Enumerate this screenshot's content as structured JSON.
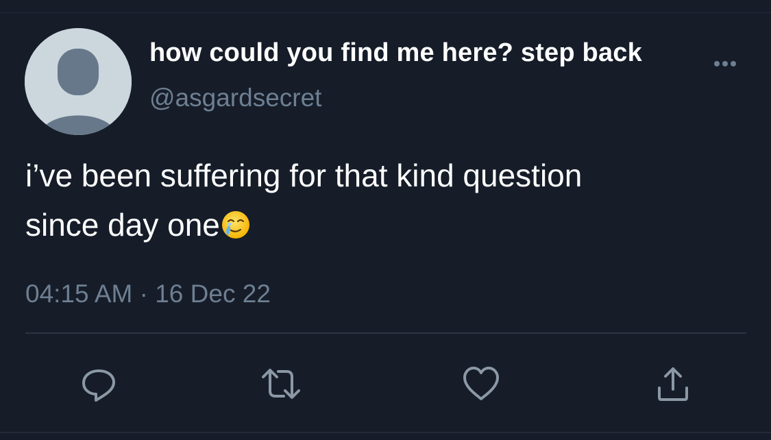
{
  "tweet": {
    "display_name": "how could you find me here? step back",
    "handle": "@asgardsecret",
    "text": "i’ve been suffering for that kind question\nsince day one",
    "emoji": "face-holding-back-tears",
    "time": "04:15 AM",
    "separator": "·",
    "date": "16 Dec 22"
  },
  "actions": {
    "reply_icon": "reply-icon",
    "retweet_icon": "retweet-icon",
    "like_icon": "heart-icon",
    "share_icon": "share-icon",
    "more_icon": "more-options-icon"
  },
  "colors": {
    "background": "#161d29",
    "primary_text": "#ffffff",
    "secondary_text": "#6e7f92",
    "icon": "#8b98a5",
    "avatar_bg": "#ccd6dd",
    "avatar_figure": "#66788a"
  }
}
